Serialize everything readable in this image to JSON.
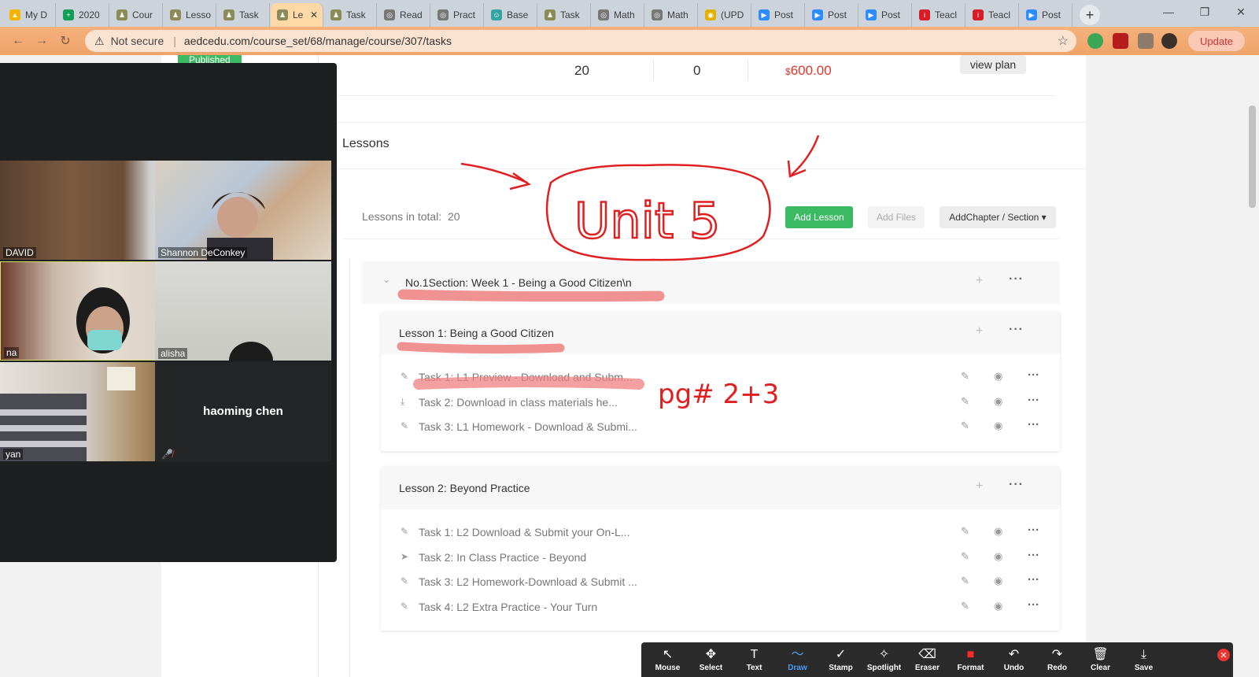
{
  "browser": {
    "tabs": [
      {
        "title": "My D",
        "color": "#f4b400",
        "glyph": "▲"
      },
      {
        "title": "2020",
        "color": "#0f9d58",
        "glyph": "+"
      },
      {
        "title": "Cour",
        "color": "#8b8b5a",
        "glyph": "♟"
      },
      {
        "title": "Lesso",
        "color": "#8b8b5a",
        "glyph": "♟"
      },
      {
        "title": "Task",
        "color": "#8b8b5a",
        "glyph": "♟"
      },
      {
        "title": "Le",
        "color": "#8b8b5a",
        "glyph": "♟",
        "active": true
      },
      {
        "title": "Task",
        "color": "#8b8b5a",
        "glyph": "♟"
      },
      {
        "title": "Read",
        "color": "#777777",
        "glyph": "◎"
      },
      {
        "title": "Pract",
        "color": "#777777",
        "glyph": "◎"
      },
      {
        "title": "Base",
        "color": "#36a3a3",
        "glyph": "☺"
      },
      {
        "title": "Task",
        "color": "#8b8b5a",
        "glyph": "♟"
      },
      {
        "title": "Math",
        "color": "#777777",
        "glyph": "◎"
      },
      {
        "title": "Math",
        "color": "#777777",
        "glyph": "◎"
      },
      {
        "title": "(UPD",
        "color": "#e2b100",
        "glyph": "◉"
      },
      {
        "title": "Post",
        "color": "#2d8cff",
        "glyph": "▶"
      },
      {
        "title": "Post",
        "color": "#2d8cff",
        "glyph": "▶"
      },
      {
        "title": "Post",
        "color": "#2d8cff",
        "glyph": "▶"
      },
      {
        "title": "Teacl",
        "color": "#d71e28",
        "glyph": "i"
      },
      {
        "title": "Teacl",
        "color": "#d71e28",
        "glyph": "i"
      },
      {
        "title": "Post",
        "color": "#2d8cff",
        "glyph": "▶"
      }
    ],
    "not_secure": "Not secure",
    "url": "aedcedu.com/course_set/68/manage/course/307/tasks",
    "update_label": "Update"
  },
  "course": {
    "published": "Published",
    "stat_1": "20",
    "stat_2": "0",
    "price_prefix": "$",
    "price": "600.00",
    "view_plan": "view plan",
    "lessons_title": "Lessons",
    "lessons_total_label": "Lessons in total:",
    "lessons_total": "20",
    "add_lesson": "Add Lesson",
    "add_files": "Add Files",
    "add_chapter": "AddChapter / Section ▾"
  },
  "section": {
    "label": "No.1Section:  Week 1 - Being a Good Citizen\\n"
  },
  "lessons": [
    {
      "label": "Lesson 1:   Being a Good Citizen",
      "tasks": [
        {
          "icon": "✎",
          "label": "Task 1:   L1 Preview - Download and Subm..."
        },
        {
          "icon": "⤓",
          "label": "Task 2:   Download in class materials he..."
        },
        {
          "icon": "✎",
          "label": "Task 3:   L1 Homework - Download & Submi..."
        }
      ]
    },
    {
      "label": "Lesson 2:   Beyond Practice",
      "tasks": [
        {
          "icon": "✎",
          "label": "Task 1:   L2 Download & Submit your On-L..."
        },
        {
          "icon": "➤",
          "label": "Task 2:   In Class Practice - Beyond"
        },
        {
          "icon": "✎",
          "label": "Task 3:   L2 Homework-Download & Submit ..."
        },
        {
          "icon": "✎",
          "label": "Task 4:   L2 Extra Practice - Your Turn"
        }
      ]
    }
  ],
  "zoom": {
    "participants": [
      "DAVID",
      "Shannon DeConkey",
      "na",
      "alisha",
      "yan",
      "haoming chen"
    ],
    "tools": [
      {
        "icon": "↖",
        "label": "Mouse",
        "name": "mouse"
      },
      {
        "icon": "✥",
        "label": "Select",
        "name": "select"
      },
      {
        "icon": "T",
        "label": "Text",
        "name": "text"
      },
      {
        "icon": "〜",
        "label": "Draw",
        "name": "draw"
      },
      {
        "icon": "✓",
        "label": "Stamp",
        "name": "stamp"
      },
      {
        "icon": "✧",
        "label": "Spotlight",
        "name": "spotlight"
      },
      {
        "icon": "⌫",
        "label": "Eraser",
        "name": "eraser"
      },
      {
        "icon": "■",
        "label": "Format",
        "name": "format"
      },
      {
        "icon": "↶",
        "label": "Undo",
        "name": "undo"
      },
      {
        "icon": "↷",
        "label": "Redo",
        "name": "redo"
      },
      {
        "icon": "🗑",
        "label": "Clear",
        "name": "clear"
      },
      {
        "icon": "⤓",
        "label": "Save",
        "name": "save"
      }
    ]
  },
  "annotations": {
    "unit": "Unit 5",
    "pages": "pg# 2+3"
  },
  "colors": {
    "accent_green": "#3cb963",
    "price_red": "#e0352b",
    "annotation_red": "#e02020",
    "highlight": "#f08080"
  }
}
